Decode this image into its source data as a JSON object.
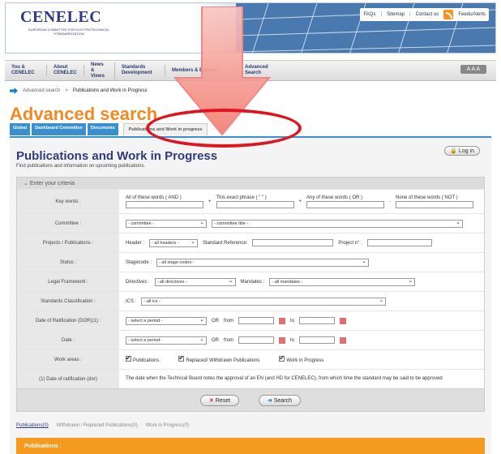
{
  "header": {
    "logo": "CENELEC",
    "logo_sub": "EUROPEAN COMMITTEE FOR ELECTROTECHNICAL STANDARDIZATION",
    "top_links": [
      "FAQs",
      "Sitemap",
      "Contact us",
      "Feeds/Alerts"
    ]
  },
  "nav": {
    "items": [
      "You & CENELEC",
      "About CENELEC",
      "News & Views",
      "Standards Development",
      "Members & Experts",
      "Advanced Search"
    ],
    "text_size": "A A A"
  },
  "breadcrumb": {
    "root": "Advanced search",
    "sep": ">",
    "current": "Publications and Work in Progress"
  },
  "page": {
    "title": "Advanced search"
  },
  "tabs": [
    "Global",
    "Dashboard Committee",
    "Documents",
    "Publications and Work in progress"
  ],
  "content": {
    "title": "Publications and Work in Progress",
    "subtitle": "Find publications and information on upcoming publications.",
    "login": "Log in"
  },
  "criteria": {
    "header": "Enter your criteria",
    "keywords": {
      "label": "Key words :",
      "all": "All of these words ( AND )",
      "exact": "This exact phrase ( \" \" )",
      "any": "Any of these words ( OR )",
      "none": "None of these words ( NOT )"
    },
    "committee": {
      "label": "Committee :",
      "select1": "- committee -",
      "select2": "- committee title -"
    },
    "projects": {
      "label": "Projects / Publications :",
      "header_lbl": "Header :",
      "header_sel": "- all headers -",
      "stdref": "Standard Reference:",
      "project": "Project n° :"
    },
    "status": {
      "label": "Status :",
      "stagecode": "Stagecode :",
      "stage_sel": "- all stage codes -"
    },
    "legal": {
      "label": "Legal Framework :",
      "directives": "Directives :",
      "dir_sel": "- all directives -",
      "mandates": "Mandates :",
      "man_sel": "- all mandates -"
    },
    "classification": {
      "label": "Standards Classification :",
      "ics": "ICS :",
      "ics_sel": "- all ics -"
    },
    "dor": {
      "label": "Date of Ratification (DOR)(1) :",
      "period": "- select a period -",
      "or": "OR",
      "from": "from",
      "to": "to"
    },
    "date": {
      "label": "Date :",
      "period": "- select a period -",
      "or": "OR",
      "from": "from",
      "to": "to"
    },
    "work_areas": {
      "label": "Work areas :",
      "a": "Publications",
      "b": "Replaced/ Withdrawn Publications",
      "c": "Work in Progress"
    },
    "note": {
      "label": "(1) Date of ratification (dor)",
      "text": "The date when the Technical Board notes the approval of an EN (and HD for CENELEC), from which time the standard may be said to be approved"
    },
    "reset": "Reset",
    "search": "Search"
  },
  "results": {
    "tabs": [
      "Publications(0)",
      "Withdrawn / Replaced Publications(0)",
      "Work in Progress(0)"
    ],
    "bar": "Publications :"
  },
  "colors": {
    "orange": "#f08a24",
    "blue": "#3a8fcf",
    "navy": "#2f3a82",
    "red": "#e0141e"
  }
}
